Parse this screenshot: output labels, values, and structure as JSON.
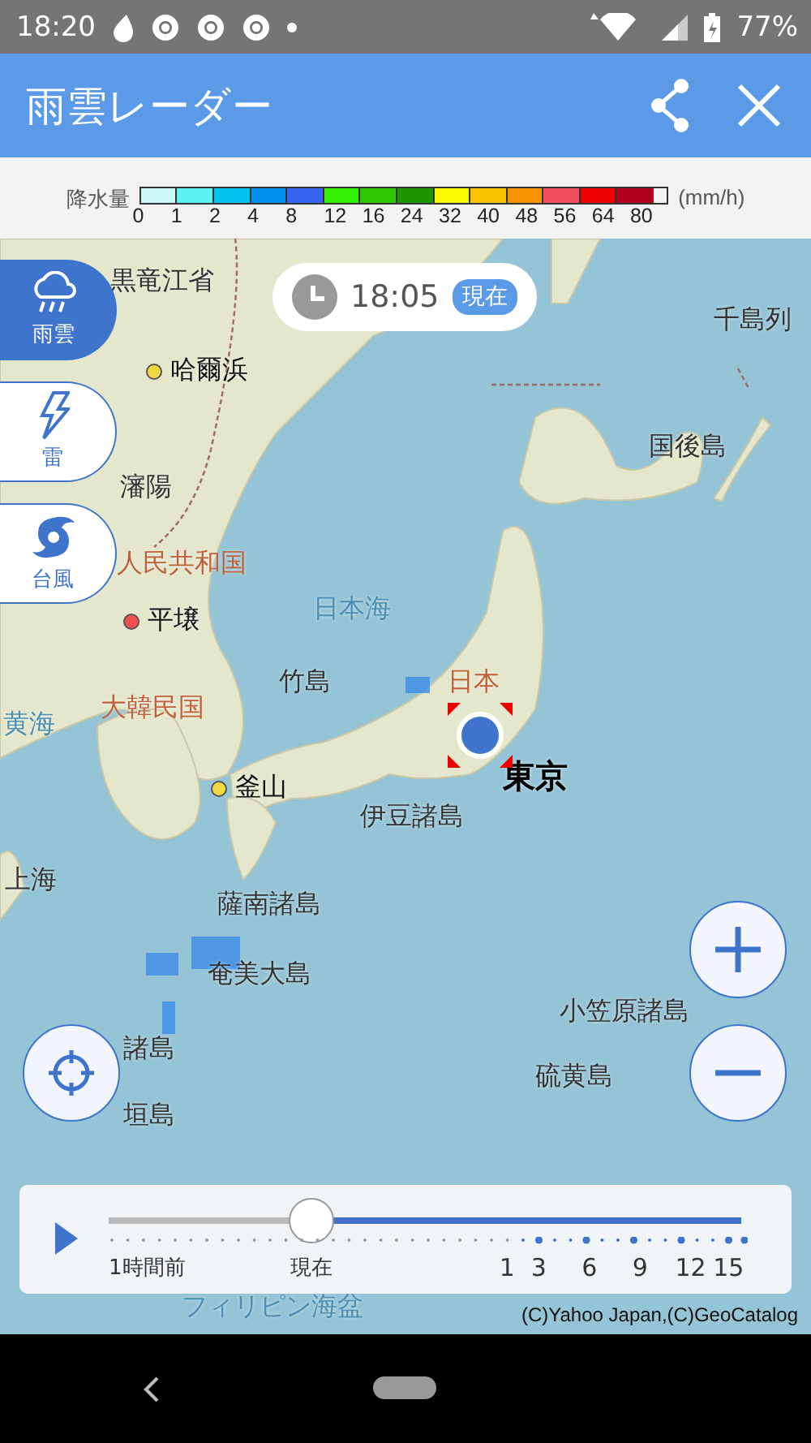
{
  "status_bar": {
    "time": "18:20",
    "battery": "77%"
  },
  "header": {
    "title": "雨雲レーダー"
  },
  "legend": {
    "label": "降水量",
    "unit": "(mm/h)",
    "scale": [
      {
        "value": "0",
        "color": "#ccf8f8"
      },
      {
        "value": "1",
        "color": "#5cf2f4"
      },
      {
        "value": "2",
        "color": "#00c4f0"
      },
      {
        "value": "4",
        "color": "#0090ee"
      },
      {
        "value": "8",
        "color": "#3464f0"
      },
      {
        "value": "12",
        "color": "#32f000"
      },
      {
        "value": "16",
        "color": "#2ec800"
      },
      {
        "value": "24",
        "color": "#1e9400"
      },
      {
        "value": "32",
        "color": "#f8f800"
      },
      {
        "value": "40",
        "color": "#f8c400"
      },
      {
        "value": "48",
        "color": "#f89400"
      },
      {
        "value": "56",
        "color": "#f24e60"
      },
      {
        "value": "64",
        "color": "#f00000"
      },
      {
        "value": "80",
        "color": "#b00020"
      }
    ]
  },
  "time_badge": {
    "time": "18:05",
    "tag": "現在"
  },
  "layers": [
    {
      "label": "雨雲",
      "kind": "rain",
      "selected": true
    },
    {
      "label": "雷",
      "kind": "thunder",
      "selected": false
    },
    {
      "label": "台風",
      "kind": "typhoon",
      "selected": false
    }
  ],
  "map_labels": [
    {
      "text": "黒竜江省",
      "kind": "place"
    },
    {
      "text": "哈爾浜",
      "kind": "city",
      "color": "#f0d840"
    },
    {
      "text": "千島列",
      "kind": "place"
    },
    {
      "text": "国後島",
      "kind": "place"
    },
    {
      "text": "瀋陽",
      "kind": "place"
    },
    {
      "text": "人民共和国",
      "kind": "country"
    },
    {
      "text": "日本海",
      "kind": "sea"
    },
    {
      "text": "平壌",
      "kind": "city",
      "color": "#f05050"
    },
    {
      "text": "竹島",
      "kind": "place"
    },
    {
      "text": "日本",
      "kind": "country"
    },
    {
      "text": "大韓民国",
      "kind": "country"
    },
    {
      "text": "黄海",
      "kind": "sea"
    },
    {
      "text": "釜山",
      "kind": "city",
      "color": "#f0d840"
    },
    {
      "text": "東京",
      "kind": "capital"
    },
    {
      "text": "伊豆諸島",
      "kind": "place"
    },
    {
      "text": "上海",
      "kind": "place"
    },
    {
      "text": "薩南諸島",
      "kind": "place"
    },
    {
      "text": "奄美大島",
      "kind": "place"
    },
    {
      "text": "小笠原諸島",
      "kind": "place"
    },
    {
      "text": "諸島",
      "kind": "place"
    },
    {
      "text": "硫黄島",
      "kind": "place"
    },
    {
      "text": "垣島",
      "kind": "place"
    },
    {
      "text": "フィリピン海盆",
      "kind": "sea"
    }
  ],
  "timeline": {
    "level": 0.32,
    "ticks": [
      "1時間前",
      "現在",
      "1",
      "3",
      "6",
      "9",
      "12",
      "15"
    ]
  },
  "copyright": "(C)Yahoo Japan,(C)GeoCatalog"
}
